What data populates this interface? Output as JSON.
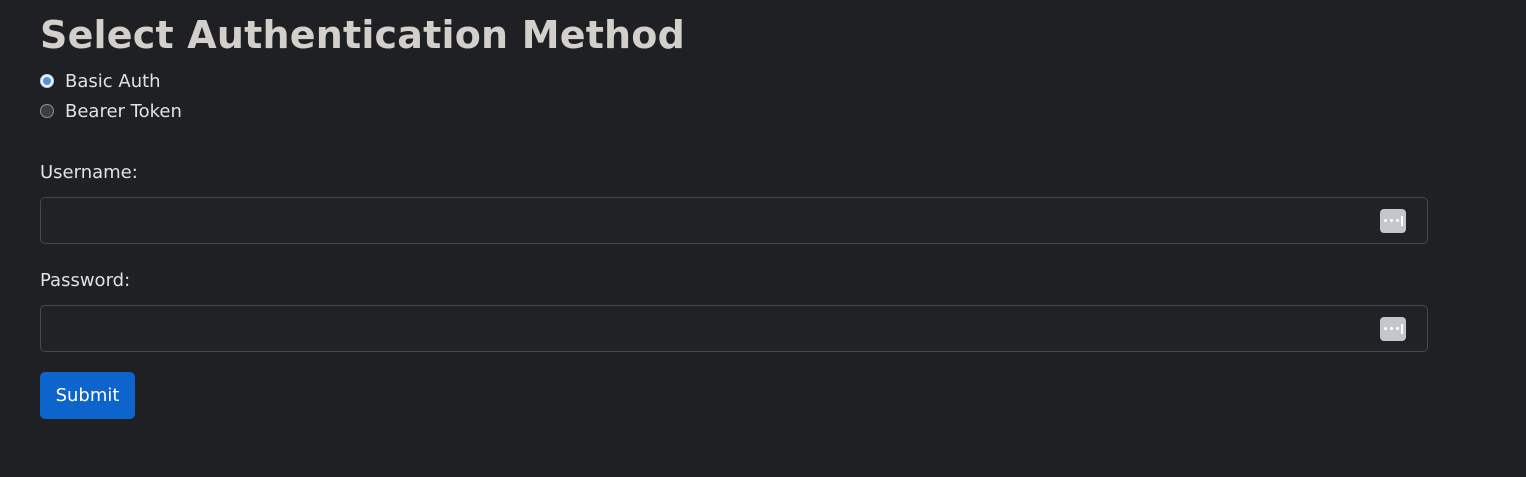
{
  "page": {
    "title": "Select Authentication Method"
  },
  "auth_methods": [
    {
      "label": "Basic Auth",
      "checked": true
    },
    {
      "label": "Bearer Token",
      "checked": false
    }
  ],
  "fields": {
    "username": {
      "label": "Username:",
      "value": "",
      "icon": "password-manager-icon"
    },
    "password": {
      "label": "Password:",
      "value": "",
      "icon": "password-manager-icon"
    }
  },
  "submit": {
    "label": "Submit"
  },
  "colors": {
    "background": "#1f2023",
    "primary_button": "#0d64cd",
    "text": "#dee2e6"
  }
}
